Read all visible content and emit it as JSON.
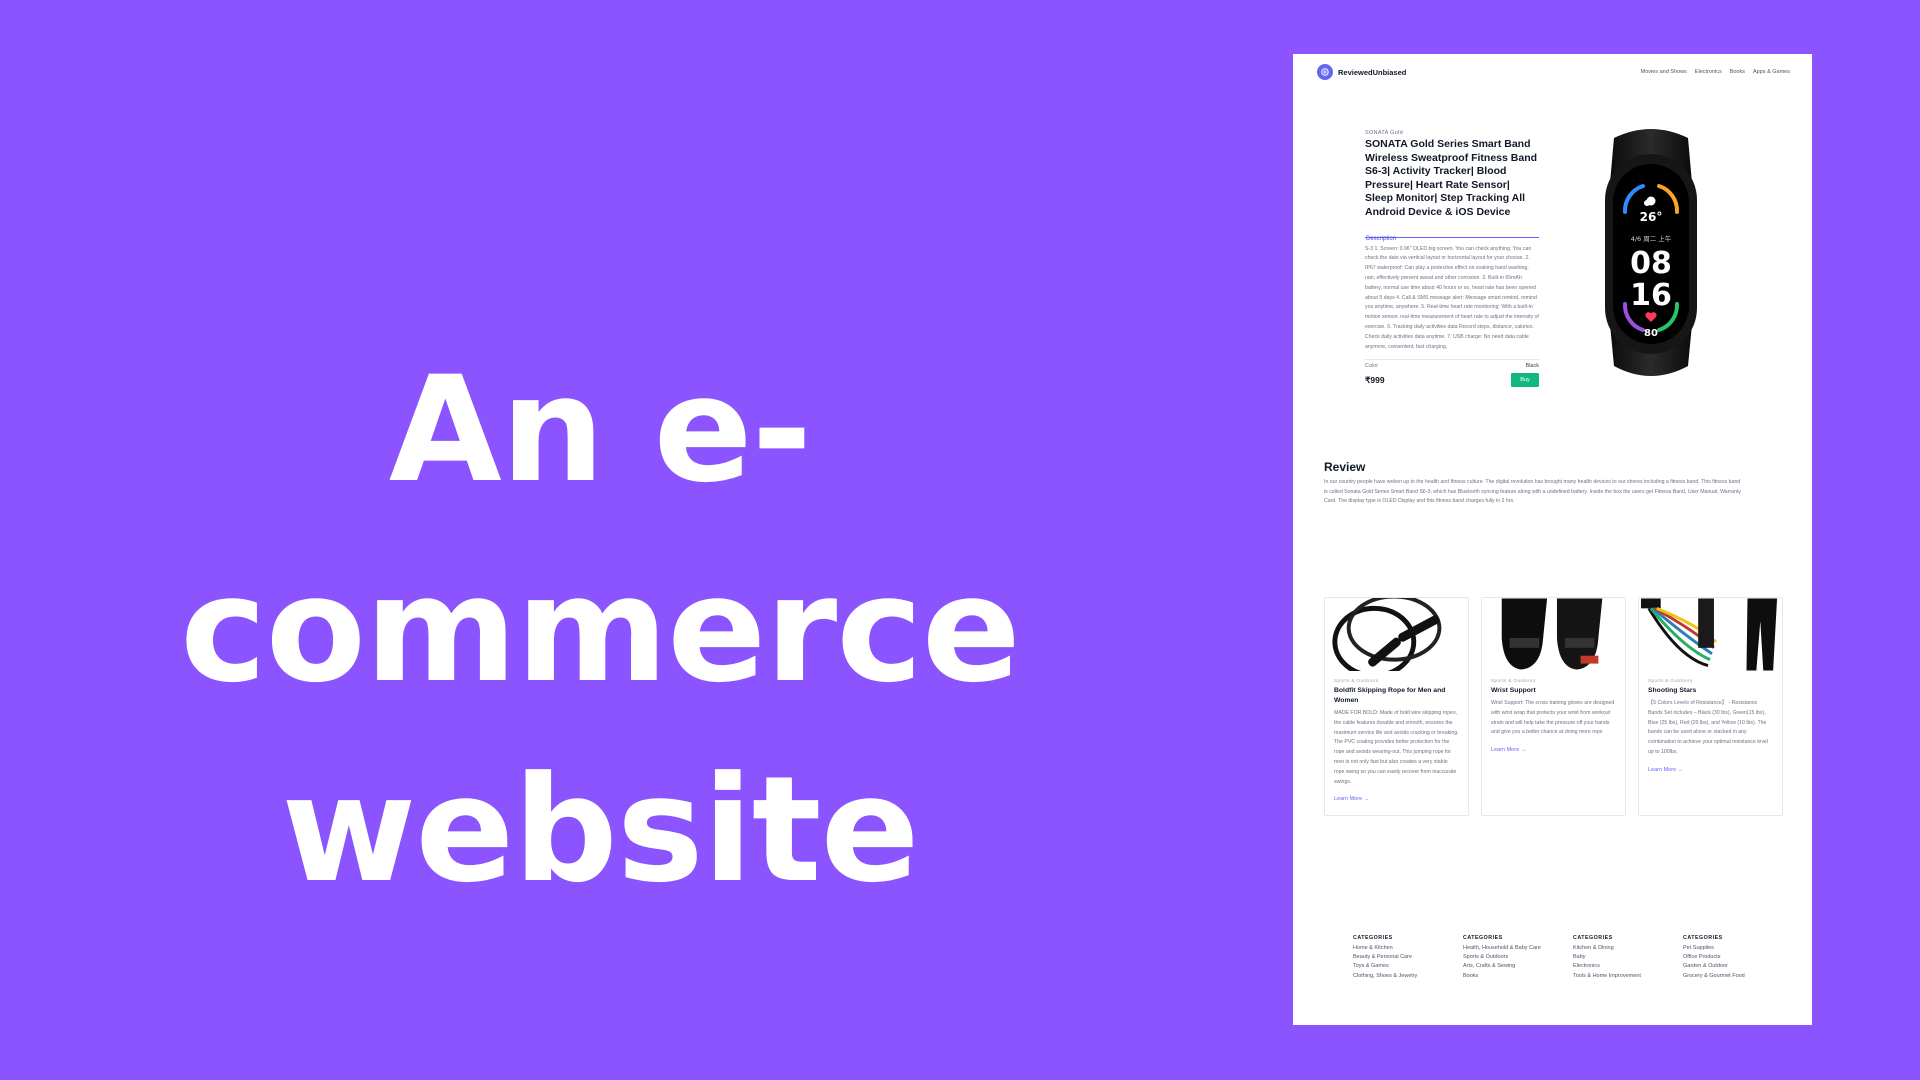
{
  "hero": {
    "line1": "An e-commerce",
    "line2": "website"
  },
  "nav": {
    "brand": "ReviewedUnbiased",
    "links": [
      "Movies and Shows",
      "Electronics",
      "Books",
      "Apps & Games"
    ]
  },
  "product": {
    "brand": "SONATA Gold",
    "title": "SONATA Gold Series Smart Band Wireless Sweatproof Fitness Band S6-3| Activity Tracker| Blood Pressure| Heart Rate Sensor| Sleep Monitor| Step Tracking All Android Device & iOS Device",
    "tab": "Description",
    "description": "S-3 1. Screen: 0.96\" OLED big screen. You can check anything. You can check the date via vertical layout or horizontal layout for your choose. 2. IP67 waterproof: Can play a protective effect on soaking hand washing, rain, effectively prevent sweat and other corrosion. 3. Built-in 65mAh battery, normal use time about 40 hours or so, heart rate has been opened about 5 days 4. Call & SMS message alert: Message smart remind, remind you anytime, anywhere. 5. Real-time heart rate monitoring: With a built-in motion sensor, real-time measurement of heart rate to adjust the intensity of exercise. 6. Tracking daily activities data Record steps, distance, calories. Check daily activities data anytime. 7. USB charge: No need data cable anymore, convenient, fast charging.",
    "color_label": "Color",
    "color_value": "Black",
    "price": "₹999",
    "buy_label": "Buy",
    "watch_face": {
      "temp": "26°",
      "date": "4/6 周二 上午",
      "hour": "08",
      "minute": "16",
      "heart": "80"
    }
  },
  "review": {
    "heading": "Review",
    "text": "In our country people have woken up to the health and fitness culture. The digital revolution has brought many health devices to our shores including a fitness band. This fitness band is called Sonata Gold Series Smart Band S6-3, which has Bluetooth syncing feature along with a undefined battery. Inside the box the users get Fitness Band, User Manual, Warranty Card. The display type is OLED Display and this fitness band charges fully in 2 hrs."
  },
  "cards": [
    {
      "category": "Sports & Outdoors",
      "title": "Boldfit Skipping Rope for Men and Women",
      "text": "MADE FOR BOLD: Made of bold wire skipping ropes, the cable features durable and smooth, ensures the maximum service life and avoids cracking or breaking. The PVC coating provides better protection for the rope and avoids wearing-out. This jumping rope for men is not only fast but also creates a very stable rope swing so you can easily recover from inaccurate swings.",
      "link": "Learn More →"
    },
    {
      "category": "Sports & Outdoors",
      "title": "Wrist Support",
      "text": "Wrist Support: The cross training gloves are designed with wrist wrap that protects your wrist from workout strain and will help take the pressure off your hands and give you a better chance at doing more reps",
      "link": "Learn More →"
    },
    {
      "category": "Sports & Outdoors",
      "title": "Shooting Stars",
      "text": "【5 Colors Levels of Resistance】 - Resistance Bands Set includes – Black (30 lbs), Green(15 lbs), Blue (25 lbs), Red (20 lbs), and Yellow (10 lbs). The bands can be used alone or stacked in any combination to achieve your optimal resistance level up to 100lbs.",
      "link": "Learn More →"
    }
  ],
  "footer": [
    {
      "heading": "CATEGORIES",
      "links": [
        "Home & Kitchen",
        "Beauty & Personal Care",
        "Toys & Games",
        "Clothing, Shoes & Jewelry"
      ]
    },
    {
      "heading": "CATEGORIES",
      "links": [
        "Health, Household & Baby Care",
        "Sports & Outdoors",
        "Arts, Crafts & Sewing",
        "Books"
      ]
    },
    {
      "heading": "CATEGORIES",
      "links": [
        "Kitchen & Dining",
        "Baby",
        "Electronics",
        "Tools & Home Improvement"
      ]
    },
    {
      "heading": "CATEGORIES",
      "links": [
        "Pet Supplies",
        "Office Products",
        "Garden & Outdoor",
        "Grocery & Gourmet Food"
      ]
    }
  ],
  "colors": {
    "background": "#8b54ff",
    "accent": "#6366f1",
    "buy": "#10b981"
  }
}
